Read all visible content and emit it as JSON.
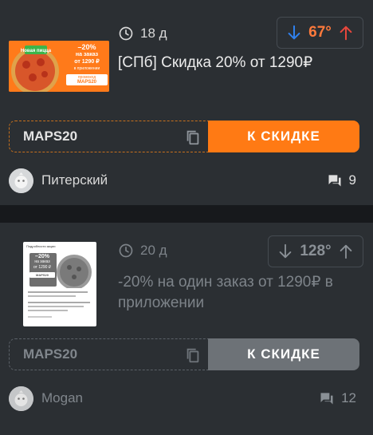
{
  "colors": {
    "accent": "#ff7a14",
    "vote_down": "#2f80ed",
    "vote_up": "#e8473c",
    "card_bg": "#2b2f33",
    "page_bg": "#17191c"
  },
  "posts": [
    {
      "age": "18 д",
      "score": "67°",
      "title": "[СПб] Скидка 20% от 1290₽",
      "promo_code": "MAPS20",
      "go_label": "К СКИДКЕ",
      "author": "Питерский",
      "comments": "9",
      "thumb": {
        "badge": "Новая пицца",
        "line1": "–20%",
        "line2": "на заказ",
        "line3": "от 1290 ₽",
        "line4": "в приложении",
        "code_caption": "промокод",
        "code": "MAPS20"
      }
    },
    {
      "age": "20 д",
      "score": "128°",
      "title": "-20% на один заказ от 1290₽ в приложении",
      "promo_code": "MAPS20",
      "go_label": "К СКИДКЕ",
      "author": "Mogan",
      "comments": "12",
      "thumb": {
        "header": "Подробности акции",
        "line1": "–20%",
        "line2": "на заказ",
        "line3": "от 1290 ₽",
        "code": "MAPS20"
      }
    }
  ]
}
